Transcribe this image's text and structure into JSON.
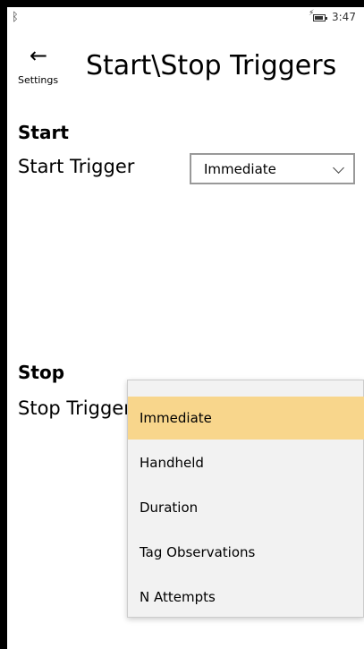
{
  "status_bar": {
    "bluetooth_icon": "bluetooth-icon",
    "battery_icon": "battery-charging-icon",
    "time": "3:47"
  },
  "header": {
    "back_icon": "back-arrow-icon",
    "back_label": "Settings",
    "title": "Start\\Stop Triggers"
  },
  "start": {
    "section_title": "Start",
    "trigger_label": "Start Trigger",
    "trigger_value": "Immediate"
  },
  "stop": {
    "section_title": "Stop",
    "trigger_label": "Stop Trigger"
  },
  "dropdown": {
    "options": [
      "Immediate",
      "Handheld",
      "Duration",
      "Tag Observations",
      "N Attempts"
    ],
    "selected": "Immediate",
    "highlight_color": "#f8d68c"
  }
}
